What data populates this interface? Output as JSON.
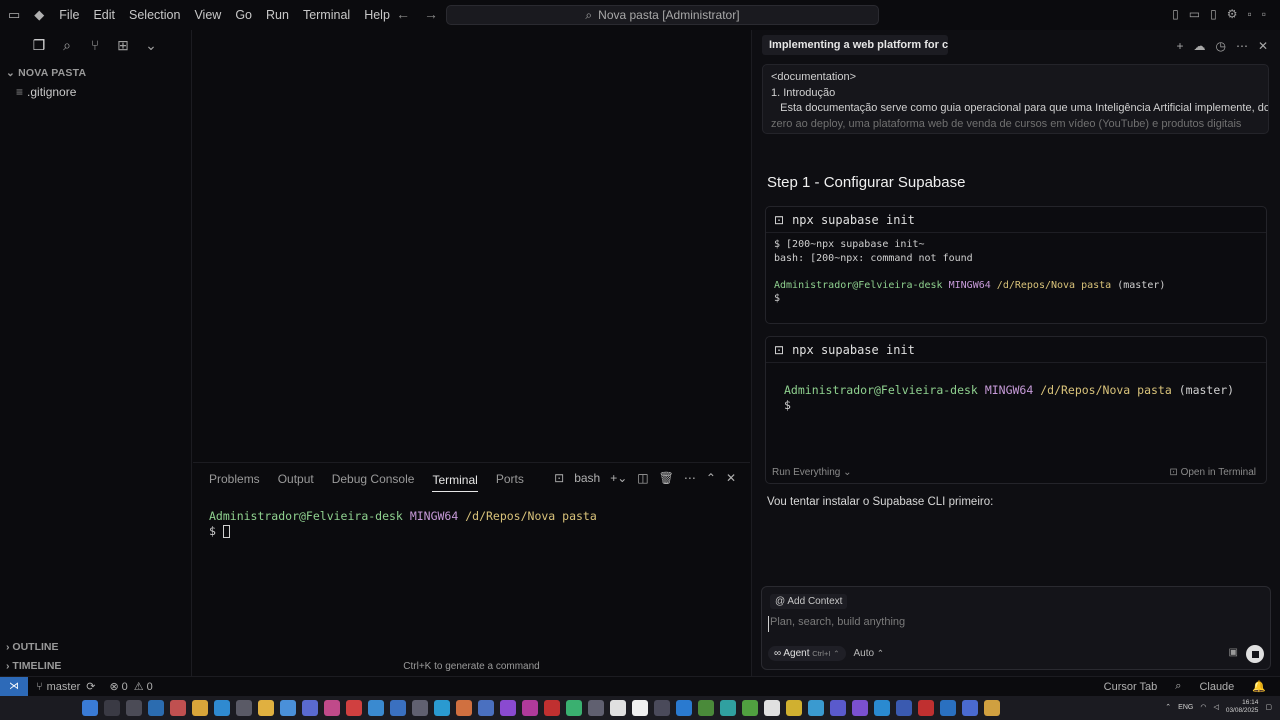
{
  "titlebar": {
    "menu": [
      "File",
      "Edit",
      "Selection",
      "View",
      "Go",
      "Run",
      "Terminal",
      "Help"
    ],
    "command_center": "Nova pasta [Administrator]"
  },
  "sidebar": {
    "folder_name": "NOVA PASTA",
    "files": [
      ".gitignore"
    ],
    "outline_label": "OUTLINE",
    "timeline_label": "TIMELINE"
  },
  "panel": {
    "tabs": [
      "Problems",
      "Output",
      "Debug Console",
      "Terminal",
      "Ports"
    ],
    "active_tab": "Terminal",
    "shell_name": "bash",
    "prompt_user": "Administrador@Felvieira-desk",
    "prompt_env": "MINGW64",
    "prompt_path": "/d/Repos/Nova pasta",
    "prompt_symbol": "$",
    "generate_hint": "Ctrl+K to generate a command"
  },
  "chat": {
    "tab_title": "Implementing a web platform for cou",
    "doc_lines": [
      "<documentation>",
      "1. Introdução",
      "   Esta documentação serve como guia operacional para que uma Inteligência Artificial implemente, do",
      "zero ao deploy, uma plataforma web de venda de cursos em vídeo (YouTube) e produtos digitais com"
    ],
    "step_title": "Step 1 - Configurar Supabase",
    "card1": {
      "command": "npx supabase init",
      "line1": "$ [200~npx supabase init~",
      "line2": "bash: [200~npx: command not found",
      "prompt_user": "Administrador@Felvieira-desk",
      "prompt_env": "MINGW64",
      "prompt_path": "/d/Repos/Nova pasta",
      "prompt_branch": "(master)",
      "prompt_symbol": "$"
    },
    "card2": {
      "command": "npx supabase init",
      "prompt_user": "Administrador@Felvieira-desk",
      "prompt_env": "MINGW64",
      "prompt_path": "/d/Repos/Nova pasta",
      "prompt_branch": "(master)",
      "prompt_symbol": "$",
      "run_label": "Run Everything",
      "open_label": "Open in Terminal"
    },
    "message": "Vou tentar instalar o Supabase CLI primeiro:",
    "composer": {
      "context_label": "Add Context",
      "placeholder": "Plan, search, build anything",
      "agent_label": "Agent",
      "agent_shortcut": "Ctrl+I",
      "mode_label": "Auto"
    }
  },
  "statusbar": {
    "branch": "master",
    "errors": "0",
    "warnings": "0",
    "cursor_tab": "Cursor Tab",
    "model": "Claude"
  },
  "taskbar": {
    "lang": "ENG",
    "time": "16:14",
    "date": "03/08/2025"
  },
  "colors": {
    "accent": "#2d6ab8",
    "prompt_green": "#8fd18f",
    "prompt_purple": "#c69ad8",
    "prompt_yellow": "#d8c27a"
  }
}
